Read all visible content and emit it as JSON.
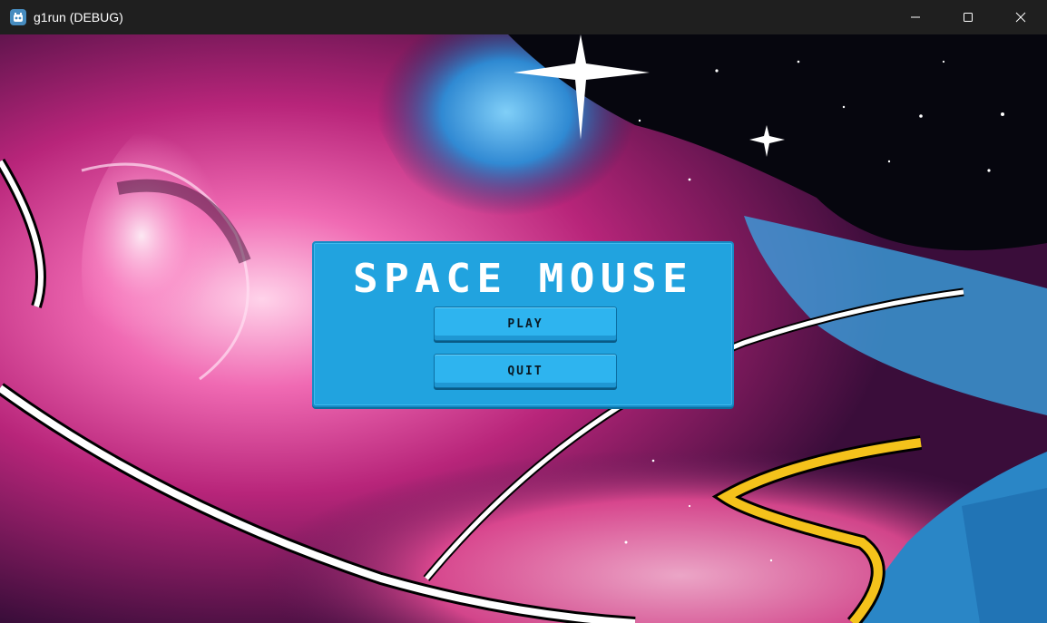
{
  "window": {
    "title": "g1run (DEBUG)",
    "app_icon": "godot-icon",
    "controls": [
      "minimize-icon",
      "maximize-icon",
      "close-icon"
    ]
  },
  "menu": {
    "game_title": "SPACE MOUSE",
    "play_label": "PLAY",
    "quit_label": "QUIT"
  },
  "colors": {
    "titlebar": "#1f1f1f",
    "panel": "#21a3df",
    "button": "#2eb4ef",
    "title_text": "#ffffff"
  }
}
